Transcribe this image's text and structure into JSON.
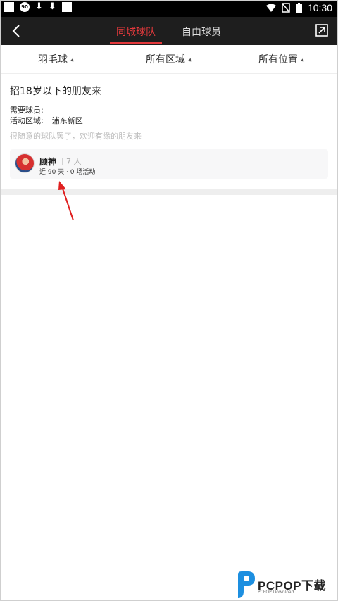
{
  "status_bar": {
    "time": "10:30",
    "logo_text": "90"
  },
  "top_bar": {
    "tabs": [
      {
        "label": "同城球队",
        "active": true
      },
      {
        "label": "自由球员",
        "active": false
      }
    ],
    "accent_color": "#e4393c"
  },
  "filters": [
    {
      "label": "羽毛球"
    },
    {
      "label": "所有区域"
    },
    {
      "label": "所有位置"
    }
  ],
  "team": {
    "title": "招18岁以下的朋友来",
    "players_needed_label": "需要球员:",
    "area_label": "活动区域:",
    "area_value": "浦东新区",
    "description": "很随意的球队罢了，欢迎有缘的朋友来",
    "owner": {
      "name": "顾神",
      "separator": "|",
      "count": "7 人",
      "activity": "近 90 天 · 0 场活动"
    }
  },
  "watermark": {
    "brand": "PCPOP下载",
    "sub": "PCPOP Download"
  }
}
